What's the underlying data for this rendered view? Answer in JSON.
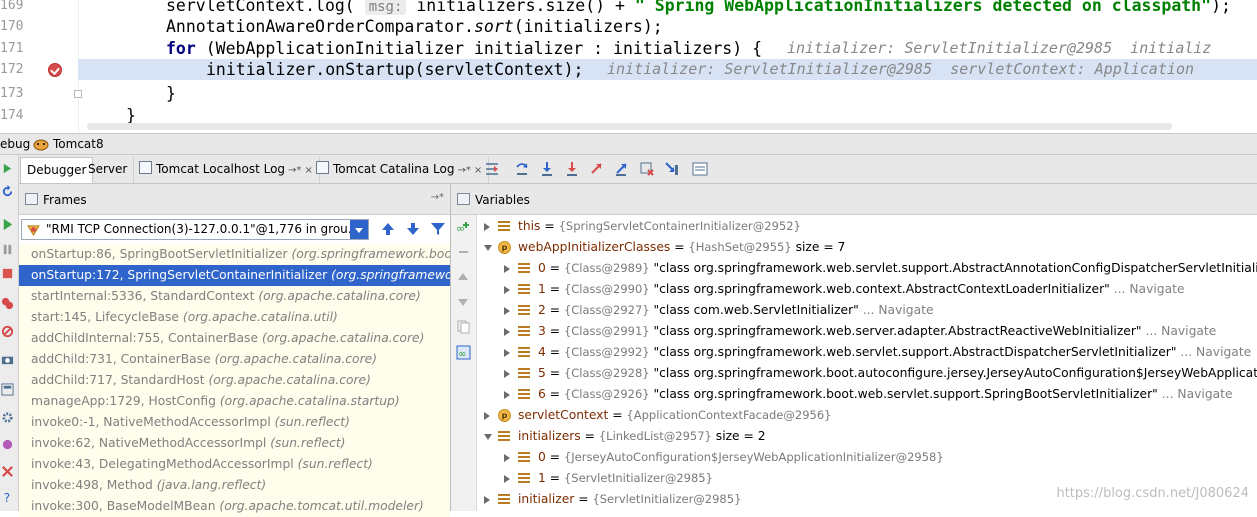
{
  "editor": {
    "lines": [
      {
        "num": "169",
        "code": "servletContext.log( ",
        "hint": "msg:",
        "rest": " initializers.size() + ",
        "str": "\" Spring WebApplicationInitializers detected on classpath\"",
        "tail": ");"
      },
      {
        "num": "170",
        "code": "AnnotationAwareOrderComparator.",
        "italic": "sort",
        "rest": "(initializers);"
      },
      {
        "num": "171",
        "kw": "for",
        "code": " (WebApplicationInitializer initializer : initializers) {",
        "inline": "initializer: ServletInitializer@2985  initializ"
      },
      {
        "num": "172",
        "code": "initializer.onStartup(servletContext);",
        "inline": "initializer: ServletInitializer@2985  servletContext: Application"
      },
      {
        "num": "173",
        "code": "}"
      },
      {
        "num": "174",
        "code": "}"
      }
    ]
  },
  "debugbar": {
    "label": "ebug",
    "config": "Tomcat8"
  },
  "tabs": [
    {
      "label": "Debugger",
      "active": true
    },
    {
      "label": "Server"
    },
    {
      "label": "Tomcat Localhost Log",
      "pin": "→*"
    },
    {
      "label": "Tomcat Catalina Log",
      "pin": "→*"
    }
  ],
  "frames": {
    "title": "Frames",
    "thread": "\"RMI TCP Connection(3)-127.0.0.1\"@1,776 in grou...",
    "list": [
      {
        "method": "onStartup:86, SpringBootServletInitializer",
        "pkg": "(org.springframework.boot.we"
      },
      {
        "method": "onStartup:172, SpringServletContainerInitializer",
        "pkg": "(org.springframework.we",
        "selected": true
      },
      {
        "method": "startInternal:5336, StandardContext",
        "pkg": "(org.apache.catalina.core)"
      },
      {
        "method": "start:145, LifecycleBase",
        "pkg": "(org.apache.catalina.util)"
      },
      {
        "method": "addChildInternal:755, ContainerBase",
        "pkg": "(org.apache.catalina.core)"
      },
      {
        "method": "addChild:731, ContainerBase",
        "pkg": "(org.apache.catalina.core)"
      },
      {
        "method": "addChild:717, StandardHost",
        "pkg": "(org.apache.catalina.core)"
      },
      {
        "method": "manageApp:1729, HostConfig",
        "pkg": "(org.apache.catalina.startup)"
      },
      {
        "method": "invoke0:-1, NativeMethodAccessorImpl",
        "pkg": "(sun.reflect)"
      },
      {
        "method": "invoke:62, NativeMethodAccessorImpl",
        "pkg": "(sun.reflect)"
      },
      {
        "method": "invoke:43, DelegatingMethodAccessorImpl",
        "pkg": "(sun.reflect)"
      },
      {
        "method": "invoke:498, Method",
        "pkg": "(java.lang.reflect)"
      },
      {
        "method": "invoke:300, BaseModelMBean",
        "pkg": "(org.apache.tomcat.util.modeler)"
      }
    ]
  },
  "variables": {
    "title": "Variables",
    "rows": [
      {
        "indent": 0,
        "arrow": "r",
        "icon": "field",
        "name": "this",
        "sep": " = ",
        "type": "{SpringServletContainerInitializer@2952}",
        "value": "",
        "nav": ""
      },
      {
        "indent": 0,
        "arrow": "d",
        "icon": "param",
        "name": "webAppInitializerClasses",
        "sep": " = ",
        "type": "{HashSet@2955}",
        "value": "  size = 7",
        "nav": ""
      },
      {
        "indent": 1,
        "arrow": "r",
        "icon": "field",
        "name": "0",
        "sep": " = ",
        "type": "{Class@2989}",
        "value": " \"class org.springframework.web.servlet.support.AbstractAnnotationConfigDispatcherServletInitializer\"",
        "nav": " ... N"
      },
      {
        "indent": 1,
        "arrow": "r",
        "icon": "field",
        "name": "1",
        "sep": " = ",
        "type": "{Class@2990}",
        "value": " \"class org.springframework.web.context.AbstractContextLoaderInitializer\"",
        "nav": " ... Navigate"
      },
      {
        "indent": 1,
        "arrow": "r",
        "icon": "field",
        "name": "2",
        "sep": " = ",
        "type": "{Class@2927}",
        "value": " \"class com.web.ServletInitializer\"",
        "nav": " ... Navigate"
      },
      {
        "indent": 1,
        "arrow": "r",
        "icon": "field",
        "name": "3",
        "sep": " = ",
        "type": "{Class@2991}",
        "value": " \"class org.springframework.web.server.adapter.AbstractReactiveWebInitializer\"",
        "nav": " ... Navigate"
      },
      {
        "indent": 1,
        "arrow": "r",
        "icon": "field",
        "name": "4",
        "sep": " = ",
        "type": "{Class@2992}",
        "value": " \"class org.springframework.web.servlet.support.AbstractDispatcherServletInitializer\"",
        "nav": " ... Navigate"
      },
      {
        "indent": 1,
        "arrow": "r",
        "icon": "field",
        "name": "5",
        "sep": " = ",
        "type": "{Class@2928}",
        "value": " \"class org.springframework.boot.autoconfigure.jersey.JerseyAutoConfiguration$JerseyWebApplicationI...",
        "nav": ""
      },
      {
        "indent": 1,
        "arrow": "r",
        "icon": "field",
        "name": "6",
        "sep": " = ",
        "type": "{Class@2926}",
        "value": " \"class org.springframework.boot.web.servlet.support.SpringBootServletInitializer\"",
        "nav": " ... Navigate"
      },
      {
        "indent": 0,
        "arrow": "r",
        "icon": "param",
        "name": "servletContext",
        "sep": " = ",
        "type": "{ApplicationContextFacade@2956}",
        "value": "",
        "nav": ""
      },
      {
        "indent": 0,
        "arrow": "d",
        "icon": "field",
        "name": "initializers",
        "sep": " = ",
        "type": "{LinkedList@2957}",
        "value": "  size = 2",
        "nav": ""
      },
      {
        "indent": 1,
        "arrow": "r",
        "icon": "field",
        "name": "0",
        "sep": " = ",
        "type": "{JerseyAutoConfiguration$JerseyWebApplicationInitializer@2958}",
        "value": "",
        "nav": ""
      },
      {
        "indent": 1,
        "arrow": "r",
        "icon": "field",
        "name": "1",
        "sep": " = ",
        "type": "{ServletInitializer@2985}",
        "value": "",
        "nav": ""
      },
      {
        "indent": 0,
        "arrow": "r",
        "icon": "field",
        "name": "initializer",
        "sep": " = ",
        "type": "{ServletInitializer@2985}",
        "value": "",
        "nav": ""
      }
    ]
  },
  "watermark": "https://blog.csdn.net/J080624",
  "colors": {
    "selection": "#2f65ca",
    "highlight_line": "#d7e3f4",
    "frame_bg": "#fffdeb",
    "var_name": "#7d2c00"
  }
}
